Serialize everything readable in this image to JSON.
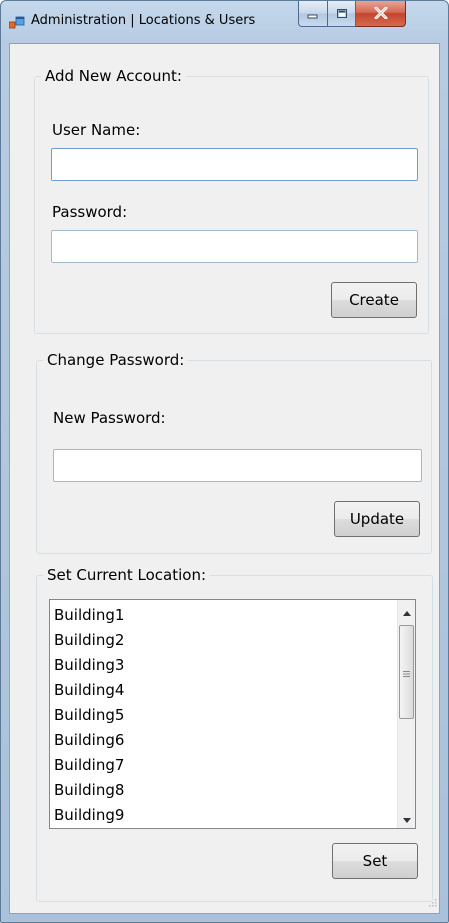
{
  "window": {
    "title": "Administration | Locations & Users"
  },
  "add_account": {
    "legend": "Add New Account:",
    "username_label": "User Name:",
    "username_value": "",
    "password_label": "Password:",
    "password_value": "",
    "create_label": "Create"
  },
  "change_password": {
    "legend": "Change Password:",
    "new_password_label": "New Password:",
    "new_password_value": "",
    "update_label": "Update"
  },
  "location": {
    "legend": "Set Current Location:",
    "items": [
      "Building1",
      "Building2",
      "Building3",
      "Building4",
      "Building5",
      "Building6",
      "Building7",
      "Building8",
      "Building9"
    ],
    "set_label": "Set"
  }
}
